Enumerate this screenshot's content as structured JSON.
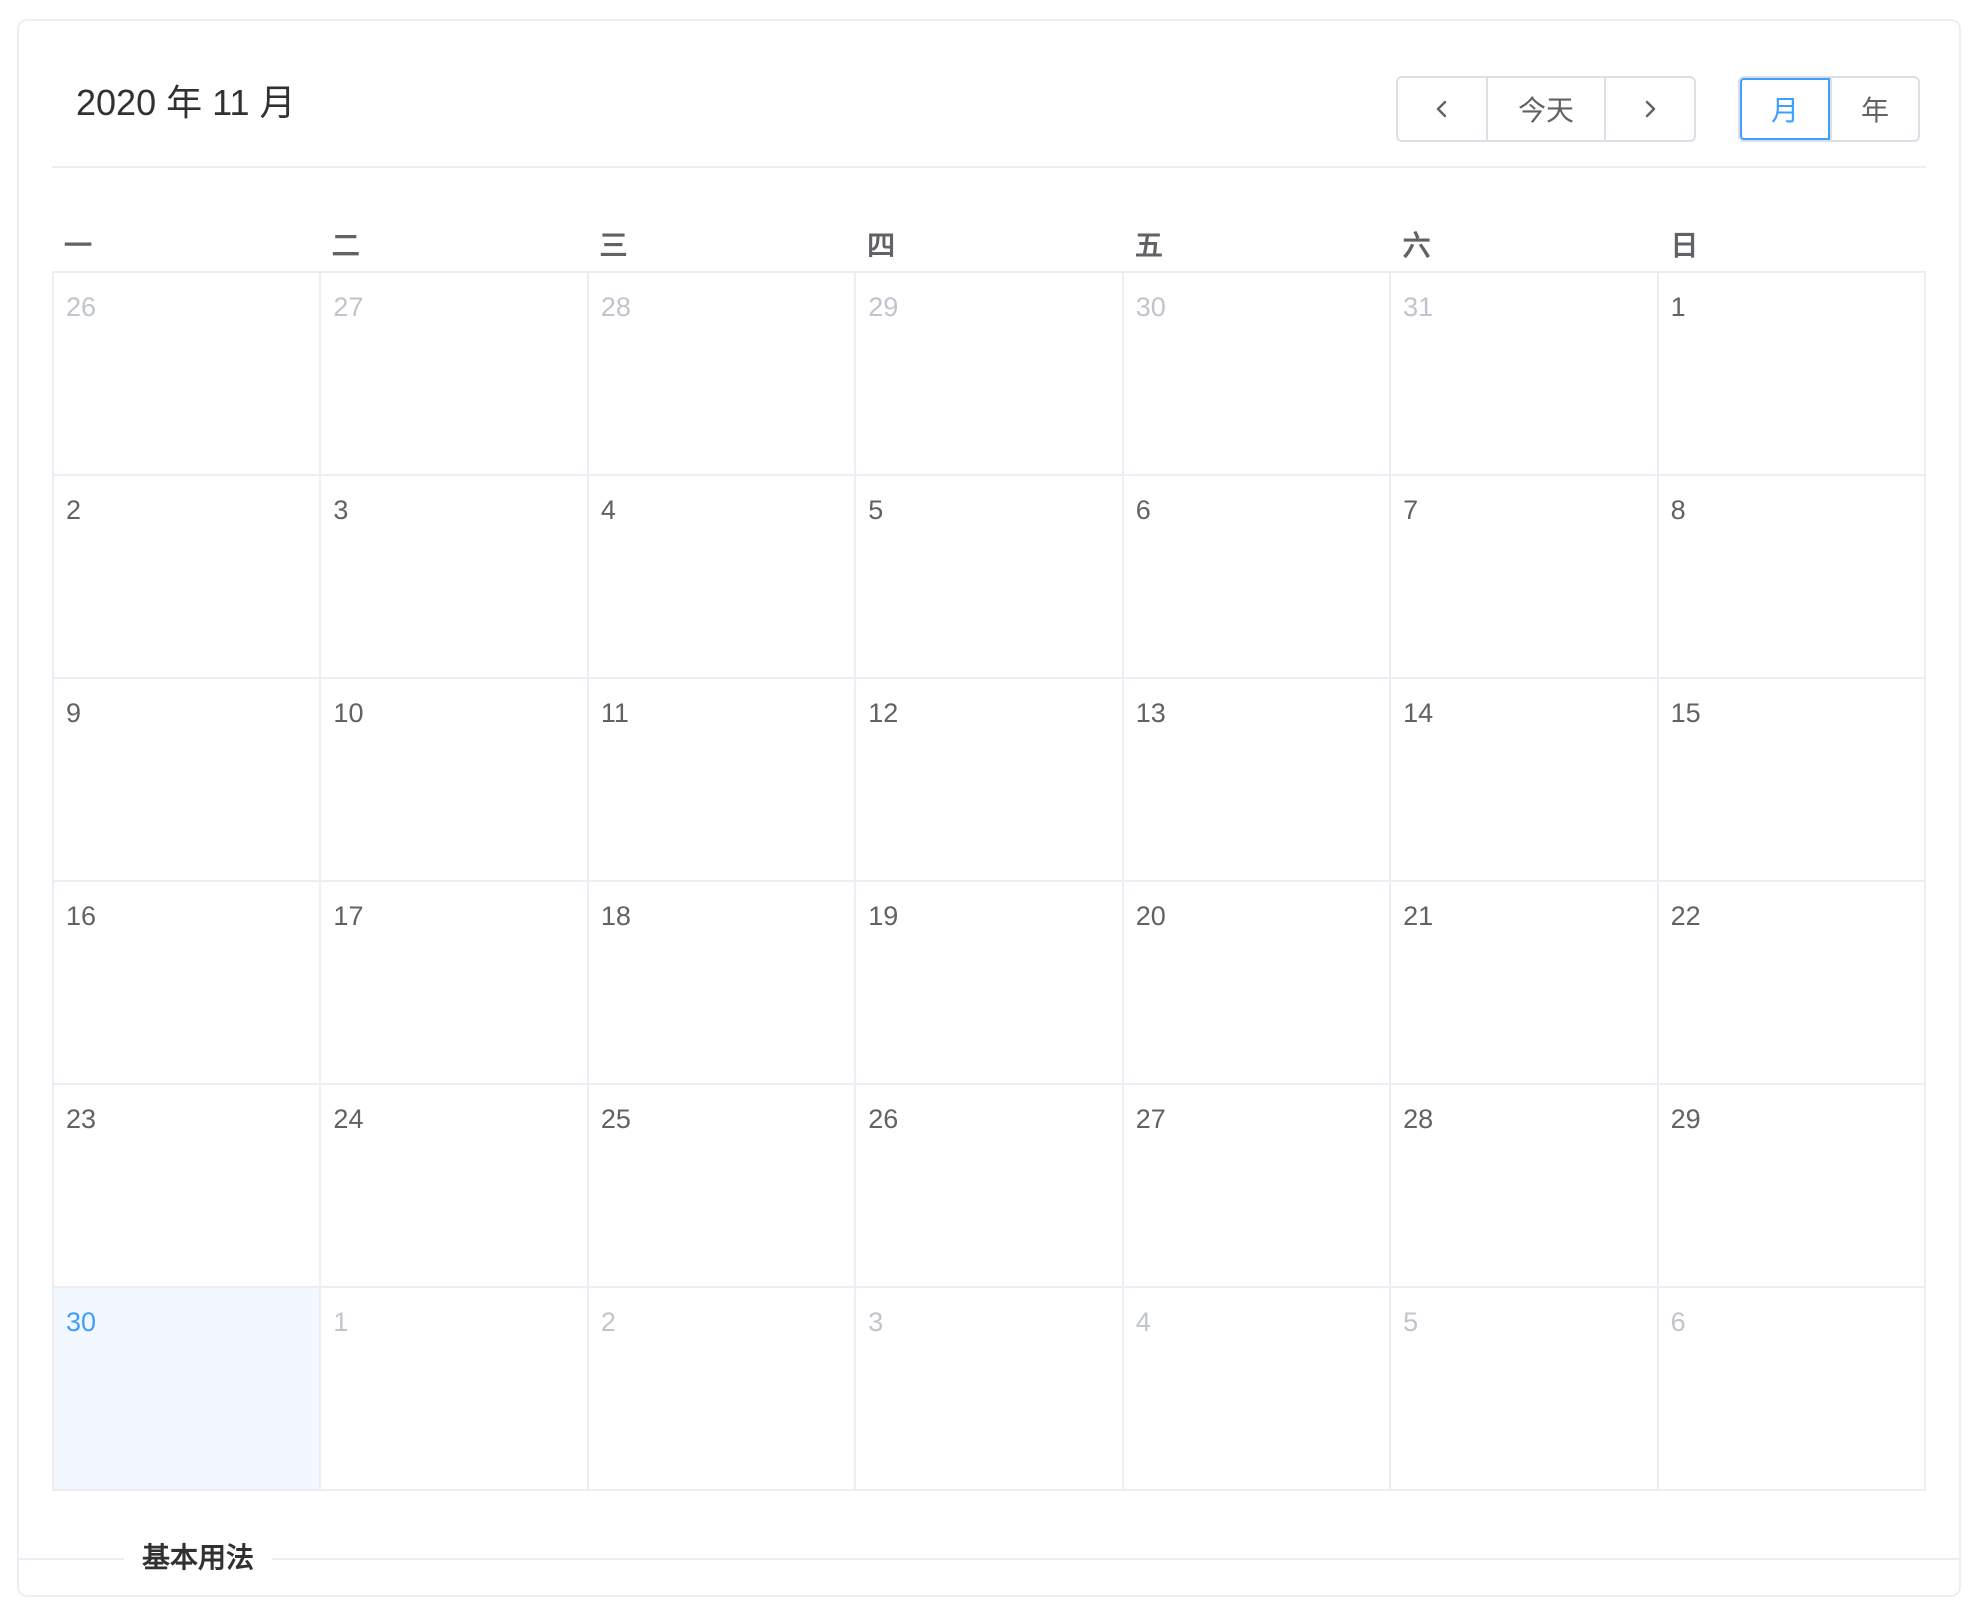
{
  "calendar": {
    "title": "2020 年 11 月",
    "controls": {
      "prev_icon": "chevron-left-icon",
      "today_label": "今天",
      "next_icon": "chevron-right-icon"
    },
    "views": {
      "month_label": "月",
      "year_label": "年",
      "selected": "月"
    },
    "weekdays": [
      "一",
      "二",
      "三",
      "四",
      "五",
      "六",
      "日"
    ],
    "weeks": [
      [
        {
          "day": "26",
          "type": "prev"
        },
        {
          "day": "27",
          "type": "prev"
        },
        {
          "day": "28",
          "type": "prev"
        },
        {
          "day": "29",
          "type": "prev"
        },
        {
          "day": "30",
          "type": "prev"
        },
        {
          "day": "31",
          "type": "prev"
        },
        {
          "day": "1",
          "type": "current-month"
        }
      ],
      [
        {
          "day": "2",
          "type": "current-month"
        },
        {
          "day": "3",
          "type": "current-month"
        },
        {
          "day": "4",
          "type": "current-month"
        },
        {
          "day": "5",
          "type": "current-month"
        },
        {
          "day": "6",
          "type": "current-month"
        },
        {
          "day": "7",
          "type": "current-month"
        },
        {
          "day": "8",
          "type": "current-month"
        }
      ],
      [
        {
          "day": "9",
          "type": "current-month"
        },
        {
          "day": "10",
          "type": "current-month"
        },
        {
          "day": "11",
          "type": "current-month"
        },
        {
          "day": "12",
          "type": "current-month"
        },
        {
          "day": "13",
          "type": "current-month"
        },
        {
          "day": "14",
          "type": "current-month"
        },
        {
          "day": "15",
          "type": "current-month"
        }
      ],
      [
        {
          "day": "16",
          "type": "current-month"
        },
        {
          "day": "17",
          "type": "current-month"
        },
        {
          "day": "18",
          "type": "current-month"
        },
        {
          "day": "19",
          "type": "current-month"
        },
        {
          "day": "20",
          "type": "current-month"
        },
        {
          "day": "21",
          "type": "current-month"
        },
        {
          "day": "22",
          "type": "current-month"
        }
      ],
      [
        {
          "day": "23",
          "type": "current-month"
        },
        {
          "day": "24",
          "type": "current-month"
        },
        {
          "day": "25",
          "type": "current-month"
        },
        {
          "day": "26",
          "type": "current-month"
        },
        {
          "day": "27",
          "type": "current-month"
        },
        {
          "day": "28",
          "type": "current-month"
        },
        {
          "day": "29",
          "type": "current-month"
        }
      ],
      [
        {
          "day": "30",
          "type": "today"
        },
        {
          "day": "1",
          "type": "next"
        },
        {
          "day": "2",
          "type": "next"
        },
        {
          "day": "3",
          "type": "next"
        },
        {
          "day": "4",
          "type": "next"
        },
        {
          "day": "5",
          "type": "next"
        },
        {
          "day": "6",
          "type": "next"
        }
      ]
    ]
  },
  "footer": {
    "label": "基本用法"
  },
  "colors": {
    "accent": "#409eff",
    "today_bg": "#f2f8fe",
    "other_month_text": "#c0c4cc",
    "text": "#606266",
    "border": "#ebeef5"
  }
}
